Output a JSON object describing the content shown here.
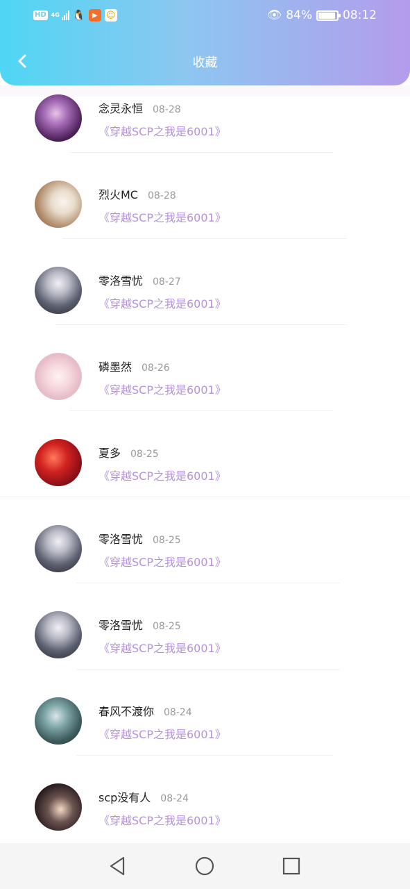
{
  "status_bar": {
    "network_badge": "HD",
    "network_type": "4G",
    "battery_percent": "84%",
    "battery_level": 0.84,
    "time": "08:12",
    "icons": [
      "hd-icon",
      "signal-icon",
      "qq-icon",
      "video-app-icon",
      "emoji-app-icon",
      "eye-icon",
      "battery-icon"
    ]
  },
  "header": {
    "title": "收藏",
    "back_icon": "chevron-left-icon",
    "gradient": [
      "#4fd6f4",
      "#b49cec"
    ]
  },
  "favorites": [
    {
      "user": "念灵永恒",
      "date": "08-28",
      "book": "《穿越SCP之我是6001》"
    },
    {
      "user": "烈火MC",
      "date": "08-28",
      "book": "《穿越SCP之我是6001》"
    },
    {
      "user": "零洛雪忧",
      "date": "08-27",
      "book": "《穿越SCP之我是6001》"
    },
    {
      "user": "磷墨然",
      "date": "08-26",
      "book": "《穿越SCP之我是6001》"
    },
    {
      "user": "夏多",
      "date": "08-25",
      "book": "《穿越SCP之我是6001》"
    },
    {
      "user": "零洛雪忧",
      "date": "08-25",
      "book": "《穿越SCP之我是6001》"
    },
    {
      "user": "零洛雪忧",
      "date": "08-25",
      "book": "《穿越SCP之我是6001》"
    },
    {
      "user": "春风不渡你",
      "date": "08-24",
      "book": "《穿越SCP之我是6001》"
    },
    {
      "user": "scp没有人",
      "date": "08-24",
      "book": "《穿越SCP之我是6001》"
    }
  ],
  "colors": {
    "book_title": "#b591dd",
    "username": "#222222",
    "date": "#999999"
  },
  "nav_bar": {
    "buttons": [
      "back-triangle-icon",
      "home-circle-icon",
      "recents-square-icon"
    ]
  }
}
